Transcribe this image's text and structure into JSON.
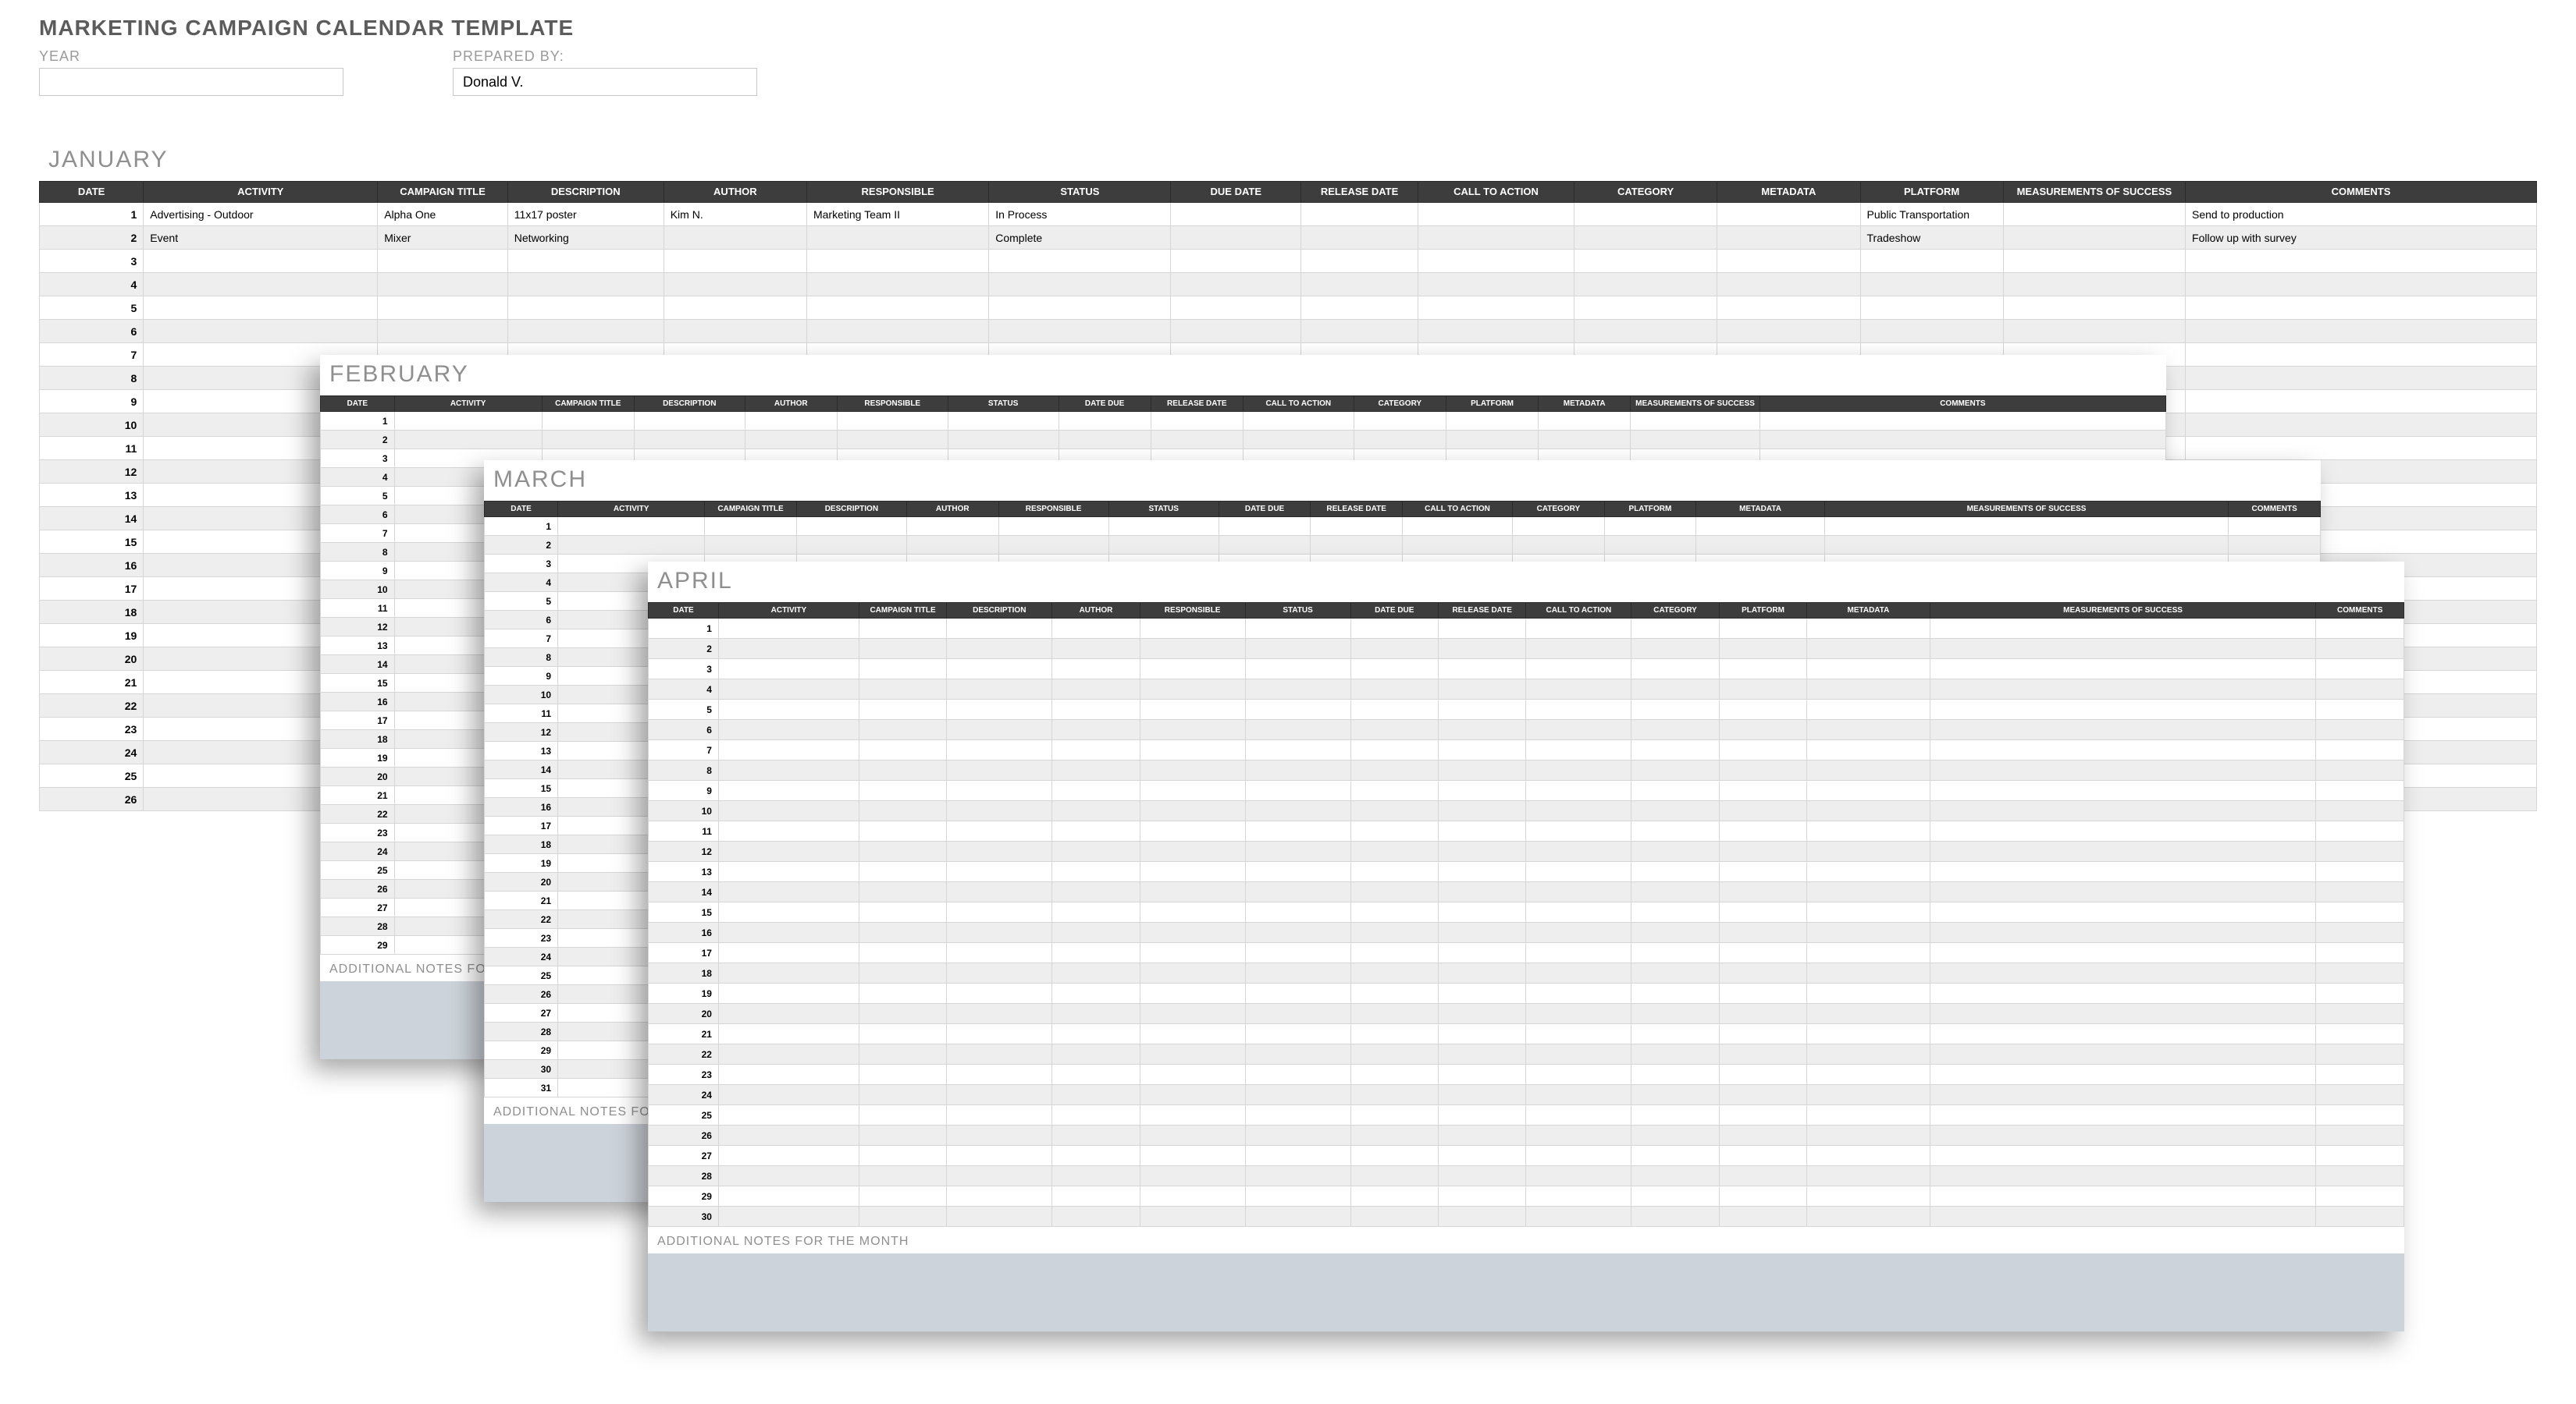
{
  "title": "MARKETING CAMPAIGN CALENDAR TEMPLATE",
  "meta": {
    "year_label": "YEAR",
    "year_value": "",
    "prepared_label": "PREPARED BY:",
    "prepared_value": "Donald V."
  },
  "columns_jan": [
    "DATE",
    "ACTIVITY",
    "CAMPAIGN TITLE",
    "DESCRIPTION",
    "AUTHOR",
    "RESPONSIBLE",
    "STATUS",
    "DUE DATE",
    "RELEASE DATE",
    "CALL TO ACTION",
    "CATEGORY",
    "METADATA",
    "PLATFORM",
    "MEASUREMENTS OF SUCCESS",
    "COMMENTS"
  ],
  "columns_other": [
    "DATE",
    "ACTIVITY",
    "CAMPAIGN TITLE",
    "DESCRIPTION",
    "AUTHOR",
    "RESPONSIBLE",
    "STATUS",
    "DATE DUE",
    "RELEASE DATE",
    "CALL TO ACTION",
    "CATEGORY",
    "PLATFORM",
    "METADATA",
    "MEASUREMENTS OF SUCCESS",
    "COMMENTS"
  ],
  "notes_label": "ADDITIONAL NOTES FOR THE MONTH",
  "months": {
    "january": {
      "title": "JANUARY",
      "rows": [
        {
          "date": "1",
          "activity": "Advertising - Outdoor",
          "campaign": "Alpha One",
          "description": "11x17 poster",
          "author": "Kim N.",
          "responsible": "Marketing Team II",
          "status": "In Process",
          "due": "",
          "release": "",
          "cta": "",
          "category": "",
          "metadata": "",
          "platform": "Public Transportation",
          "measure": "",
          "comments": "Send to production"
        },
        {
          "date": "2",
          "activity": "Event",
          "campaign": "Mixer",
          "description": "Networking",
          "author": "",
          "responsible": "",
          "status": "Complete",
          "due": "",
          "release": "",
          "cta": "",
          "category": "",
          "metadata": "",
          "platform": "Tradeshow",
          "measure": "",
          "comments": "Follow up with survey"
        },
        {
          "date": "3"
        },
        {
          "date": "4"
        },
        {
          "date": "5"
        },
        {
          "date": "6"
        },
        {
          "date": "7"
        },
        {
          "date": "8"
        },
        {
          "date": "9"
        },
        {
          "date": "10"
        },
        {
          "date": "11"
        },
        {
          "date": "12"
        },
        {
          "date": "13"
        },
        {
          "date": "14"
        },
        {
          "date": "15"
        },
        {
          "date": "16"
        },
        {
          "date": "17"
        },
        {
          "date": "18"
        },
        {
          "date": "19"
        },
        {
          "date": "20"
        },
        {
          "date": "21"
        },
        {
          "date": "22"
        },
        {
          "date": "23"
        },
        {
          "date": "24"
        },
        {
          "date": "25"
        },
        {
          "date": "26"
        }
      ]
    },
    "february": {
      "title": "FEBRUARY",
      "rows": [
        {
          "date": "1"
        },
        {
          "date": "2"
        },
        {
          "date": "3"
        },
        {
          "date": "4"
        },
        {
          "date": "5"
        },
        {
          "date": "6"
        },
        {
          "date": "7"
        },
        {
          "date": "8"
        },
        {
          "date": "9"
        },
        {
          "date": "10"
        },
        {
          "date": "11"
        },
        {
          "date": "12"
        },
        {
          "date": "13"
        },
        {
          "date": "14"
        },
        {
          "date": "15"
        },
        {
          "date": "16"
        },
        {
          "date": "17"
        },
        {
          "date": "18"
        },
        {
          "date": "19"
        },
        {
          "date": "20"
        },
        {
          "date": "21"
        },
        {
          "date": "22"
        },
        {
          "date": "23"
        },
        {
          "date": "24"
        },
        {
          "date": "25"
        },
        {
          "date": "26"
        },
        {
          "date": "27"
        },
        {
          "date": "28"
        },
        {
          "date": "29"
        }
      ]
    },
    "march": {
      "title": "MARCH",
      "rows": [
        {
          "date": "1"
        },
        {
          "date": "2"
        },
        {
          "date": "3"
        },
        {
          "date": "4"
        },
        {
          "date": "5"
        },
        {
          "date": "6"
        },
        {
          "date": "7"
        },
        {
          "date": "8"
        },
        {
          "date": "9"
        },
        {
          "date": "10"
        },
        {
          "date": "11"
        },
        {
          "date": "12"
        },
        {
          "date": "13"
        },
        {
          "date": "14"
        },
        {
          "date": "15"
        },
        {
          "date": "16"
        },
        {
          "date": "17"
        },
        {
          "date": "18"
        },
        {
          "date": "19"
        },
        {
          "date": "20"
        },
        {
          "date": "21"
        },
        {
          "date": "22"
        },
        {
          "date": "23"
        },
        {
          "date": "24"
        },
        {
          "date": "25"
        },
        {
          "date": "26"
        },
        {
          "date": "27"
        },
        {
          "date": "28"
        },
        {
          "date": "29"
        },
        {
          "date": "30"
        },
        {
          "date": "31"
        }
      ]
    },
    "april": {
      "title": "APRIL",
      "rows": [
        {
          "date": "1"
        },
        {
          "date": "2"
        },
        {
          "date": "3"
        },
        {
          "date": "4"
        },
        {
          "date": "5"
        },
        {
          "date": "6"
        },
        {
          "date": "7"
        },
        {
          "date": "8"
        },
        {
          "date": "9"
        },
        {
          "date": "10"
        },
        {
          "date": "11"
        },
        {
          "date": "12"
        },
        {
          "date": "13"
        },
        {
          "date": "14"
        },
        {
          "date": "15"
        },
        {
          "date": "16"
        },
        {
          "date": "17"
        },
        {
          "date": "18"
        },
        {
          "date": "19"
        },
        {
          "date": "20"
        },
        {
          "date": "21"
        },
        {
          "date": "22"
        },
        {
          "date": "23"
        },
        {
          "date": "24"
        },
        {
          "date": "25"
        },
        {
          "date": "26"
        },
        {
          "date": "27"
        },
        {
          "date": "28"
        },
        {
          "date": "29"
        },
        {
          "date": "30"
        }
      ]
    }
  }
}
